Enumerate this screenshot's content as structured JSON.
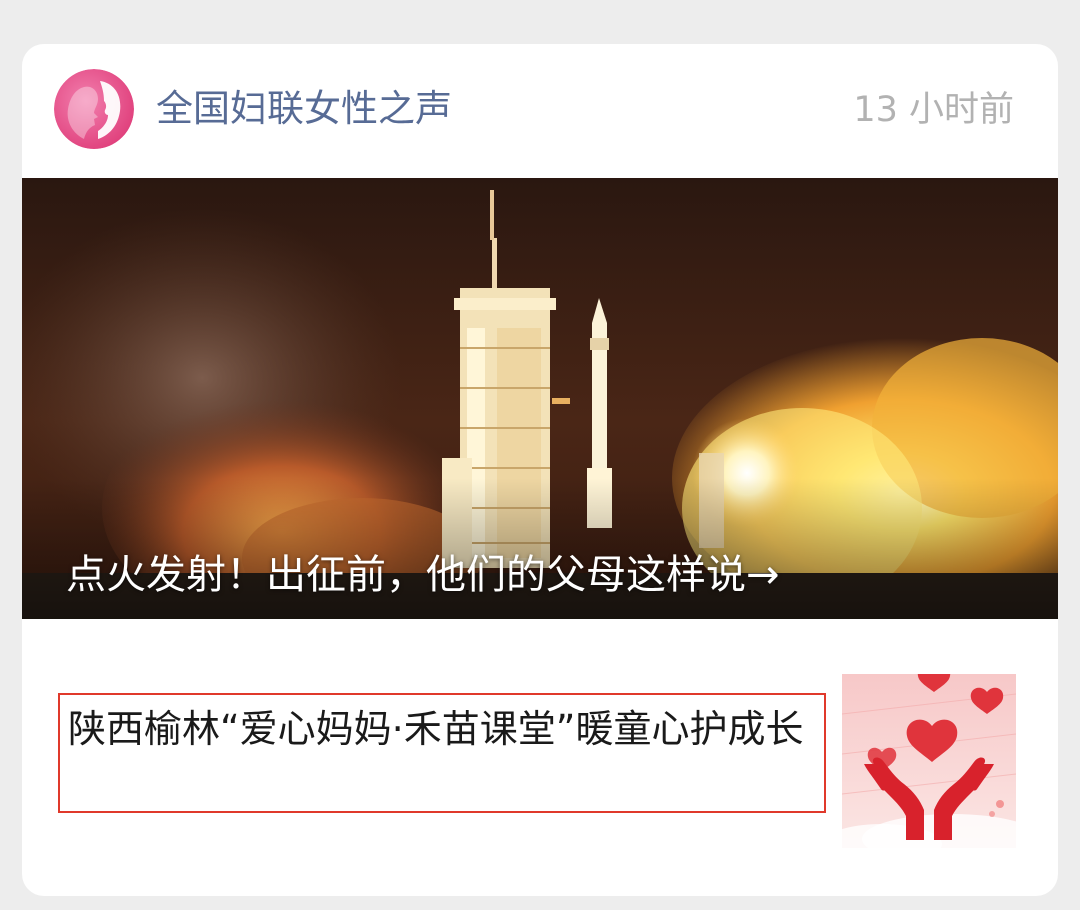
{
  "header": {
    "account_name": "全国妇联女性之声",
    "timestamp": "13 小时前",
    "avatar_icon": "woman-profile-icon",
    "brand_color": "#e8508c"
  },
  "main_article": {
    "title": "点火发射！出征前，他们的父母这样说→",
    "image": "rocket-launch-photo"
  },
  "sub_article": {
    "title": "陕西榆林“爱心妈妈·禾苗课堂”暖童心护成长",
    "thumbnail": "hands-holding-hearts-icon",
    "highlight_color": "#e0392b"
  }
}
